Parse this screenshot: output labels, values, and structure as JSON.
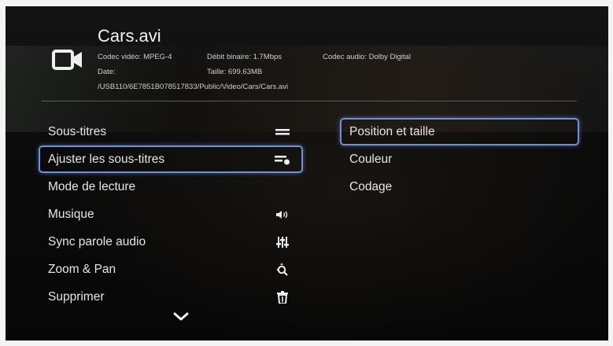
{
  "file": {
    "icon": "video-camera-icon",
    "title": "Cars.avi",
    "video_codec": "Codec vidéo: MPEG-4",
    "bitrate": "Débit binaire: 1.7Mbps",
    "audio_codec": "Codec audio: Dolby Digital",
    "date": "Date:",
    "size": "Taille: 699.63MB",
    "path": "/USB110/6E7851B078517833/Public/Video/Cars/Cars.avi"
  },
  "menu": {
    "items": [
      {
        "label": "Sous-titres",
        "icon": "subtitles-icon"
      },
      {
        "label": "Ajuster les sous-titres",
        "icon": "adjust-subtitles-icon"
      },
      {
        "label": "Mode de lecture",
        "icon": ""
      },
      {
        "label": "Musique",
        "icon": "speaker-icon"
      },
      {
        "label": "Sync parole audio",
        "icon": "equalizer-sliders-icon"
      },
      {
        "label": "Zoom & Pan",
        "icon": "zoom-icon"
      },
      {
        "label": "Supprimer",
        "icon": "trash-icon"
      }
    ],
    "more_icon": "chevron-down-icon"
  },
  "submenu": {
    "items": [
      {
        "label": "Position et taille"
      },
      {
        "label": "Couleur"
      },
      {
        "label": "Codage"
      }
    ]
  },
  "colors": {
    "selection_border": "#6f8fd6",
    "text": "#e6e6e6"
  }
}
